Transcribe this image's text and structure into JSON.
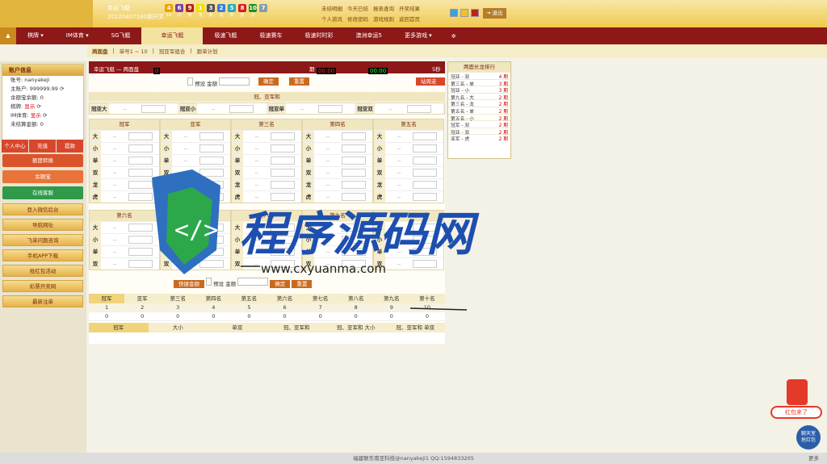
{
  "header": {
    "game_name": "幸运飞艇",
    "issue": "20220407180期开奖",
    "balls": [
      {
        "n": "4",
        "c": "#f0a000",
        "l": "10"
      },
      {
        "n": "6",
        "c": "#7b3fa0",
        "l": "小"
      },
      {
        "n": "9",
        "c": "#b52020",
        "l": "双"
      },
      {
        "n": "1",
        "c": "#f0e000",
        "l": "龙"
      },
      {
        "n": "3",
        "c": "#555555",
        "l": "虎"
      },
      {
        "n": "2",
        "c": "#3a7bd5",
        "l": "龙"
      },
      {
        "n": "5",
        "c": "#2aa8b8",
        "l": "虎"
      },
      {
        "n": "8",
        "c": "#d02020",
        "l": "虎"
      },
      {
        "n": "10",
        "c": "#208c20",
        "l": "龙"
      },
      {
        "n": "7",
        "c": "#8899aa",
        "l": ""
      }
    ],
    "links": [
      "未结明细",
      "今天已结",
      "报表查询",
      "开奖结果",
      "个人资讯",
      "修改密码",
      "游戏规则",
      "返回首页"
    ],
    "logout": "退出"
  },
  "nav": {
    "tabs": [
      "棋牌",
      "IM体育",
      "SG飞艇",
      "幸运飞艇",
      "极速飞艇",
      "极速赛车",
      "极速时时彩",
      "澳洲幸运5",
      "更多游戏"
    ],
    "active": 3
  },
  "subnav": [
    "两面盘",
    "单号1 ~ 10",
    "冠亚军组合",
    "跟单计划"
  ],
  "account": {
    "title": "账户信息",
    "user": "账号: nanyakeji",
    "main": "主账户: 999999.99",
    "balance": "余额宝余额: 0",
    "chess": "棋牌:",
    "im": "IM体育:",
    "show": "显示",
    "unsettled": "未结算金额: 0"
  },
  "quick": [
    "个人中心",
    "充值",
    "提款"
  ],
  "side_buttons": [
    {
      "label": "额度转换",
      "c": "#d9542b"
    },
    {
      "label": "余额宝",
      "c": "#e8743a"
    },
    {
      "label": "在线客服",
      "c": "#2e9a4a"
    }
  ],
  "side_links": [
    "登入微信后台",
    "导航网址",
    "飞单问题咨询",
    "手机APP下载",
    "抢红包活动",
    "彩票开奖网",
    "最新注单"
  ],
  "bar": {
    "left": "幸运飞艇 — 两面盘",
    "today_label": "今日输赢:",
    "today": "0",
    "issue": "期",
    "close_label": "距离封盘:",
    "close": "00:00",
    "open_label": "距离开奖:",
    "open": "00:00",
    "secs": "5秒"
  },
  "controls": {
    "preset": "预设",
    "amount": "金额",
    "confirm": "确定",
    "reset": "重置",
    "wallet": "站周走势",
    "quick": "快捷金额"
  },
  "sum_section": "冠、亚军和",
  "sum_items": [
    "冠亚大",
    "冠亚小",
    "冠亚单",
    "冠亚双"
  ],
  "ranks_top": [
    "冠军",
    "亚军",
    "第三名",
    "第四名",
    "第五名"
  ],
  "ranks_bottom": [
    "第六名",
    "第七名",
    "第八名",
    "第九名",
    "第十名"
  ],
  "keys": [
    "大",
    "小",
    "单",
    "双",
    "龙",
    "虎"
  ],
  "odds": "--",
  "right_panel": {
    "title": "两面长龙排行",
    "rows": [
      [
        "冠亚 - 双",
        "4 期"
      ],
      [
        "第三名 - 单",
        "3 期"
      ],
      [
        "冠亚 - 小",
        "3 期"
      ],
      [
        "第九名 - 大",
        "2 期"
      ],
      [
        "第三名 - 龙",
        "2 期"
      ],
      [
        "第五名 - 单",
        "2 期"
      ],
      [
        "第五名 - 小",
        "2 期"
      ],
      [
        "冠军 - 双",
        "2 期"
      ],
      [
        "冠亚 - 双",
        "2 期"
      ],
      [
        "亚军 - 虎",
        "2 期"
      ]
    ]
  },
  "stats": {
    "tabs": [
      "冠军",
      "亚军",
      "第三名",
      "第四名",
      "第五名",
      "第六名",
      "第七名",
      "第八名",
      "第九名",
      "第十名"
    ],
    "nums": [
      "1",
      "2",
      "3",
      "4",
      "5",
      "6",
      "7",
      "8",
      "9",
      "10"
    ],
    "vals": [
      "0",
      "0",
      "0",
      "0",
      "0",
      "0",
      "0",
      "0",
      "0",
      "0"
    ],
    "sub": [
      "冠军",
      "大小",
      "单双",
      "冠、亚军和",
      "冠、亚军和 大小",
      "冠、亚军和 单双"
    ]
  },
  "footer": "福建联东南亚科技@nanyakeji1 QQ:1594833205",
  "more": "更多",
  "watermark": {
    "cn": "程序源码网",
    "url": "www.cxyuanma.com"
  },
  "redpack": {
    "t1": "红包来了",
    "t2": "聊天室",
    "t3": "抢红包"
  }
}
